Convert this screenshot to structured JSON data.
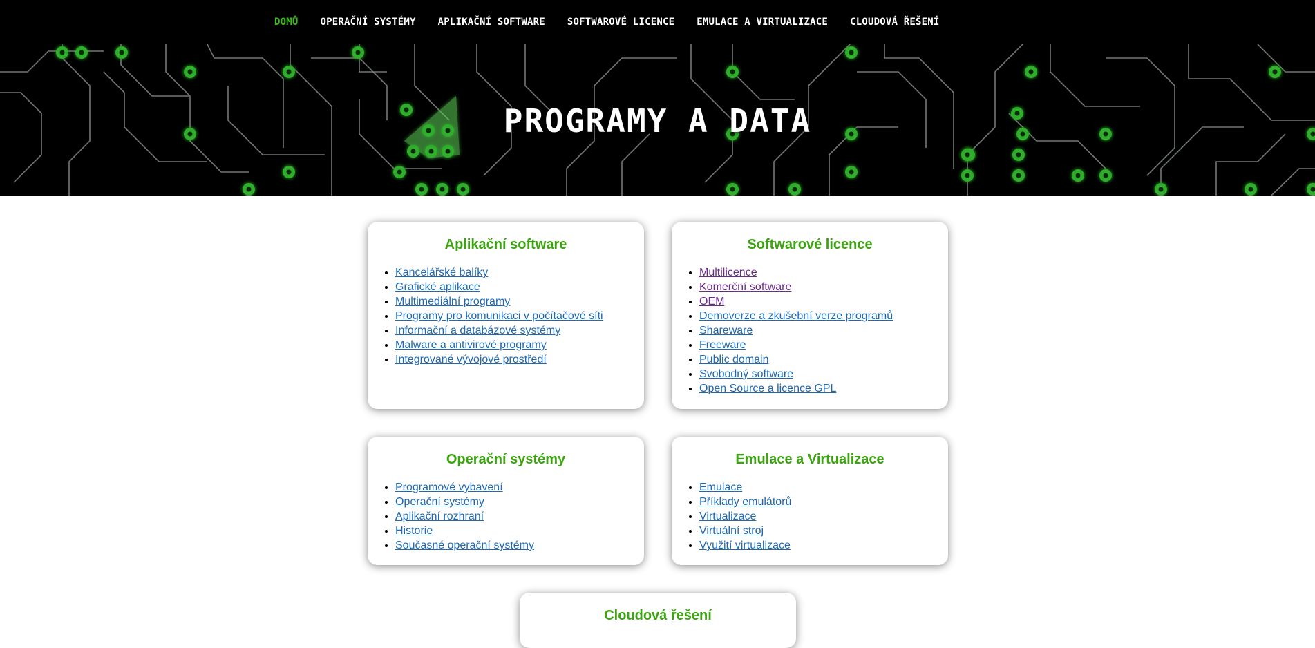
{
  "nav": [
    {
      "label": "DOMŮ",
      "active": true
    },
    {
      "label": "OPERAČNÍ SYSTÉMY",
      "active": false
    },
    {
      "label": "APLIKAČNÍ SOFTWARE",
      "active": false
    },
    {
      "label": "SOFTWAROVÉ LICENCE",
      "active": false
    },
    {
      "label": "EMULACE A VIRTUALIZACE",
      "active": false
    },
    {
      "label": "CLOUDOVÁ ŘEŠENÍ",
      "active": false
    }
  ],
  "hero": {
    "title": "PROGRAMY A DATA"
  },
  "colors": {
    "accent": "#3aa50f",
    "nav_active": "#3cbf1c",
    "link": "#1d69b4",
    "visited": "#6b2c8f"
  },
  "cards": [
    {
      "title": "Aplikační software",
      "links": [
        {
          "label": "Kancelářské balíky"
        },
        {
          "label": "Grafické aplikace"
        },
        {
          "label": "Multimediální programy"
        },
        {
          "label": "Programy pro komunikaci v počítačové síti"
        },
        {
          "label": "Informační a databázové systémy"
        },
        {
          "label": "Malware a antivirové programy"
        },
        {
          "label": "Integrované vývojové prostředí"
        }
      ]
    },
    {
      "title": "Softwarové licence",
      "links": [
        {
          "label": "Multilicence",
          "visited": true
        },
        {
          "label": "Komerční software",
          "visited": true
        },
        {
          "label": "OEM",
          "visited": true
        },
        {
          "label": "Demoverze a zkušební verze programů"
        },
        {
          "label": "Shareware"
        },
        {
          "label": "Freeware"
        },
        {
          "label": "Public domain"
        },
        {
          "label": "Svobodný software"
        },
        {
          "label": "Open Source a licence GPL"
        }
      ]
    },
    {
      "title": "Operační systémy",
      "links": [
        {
          "label": "Programové vybavení"
        },
        {
          "label": "Operační systémy"
        },
        {
          "label": "Aplikační rozhraní"
        },
        {
          "label": "Historie"
        },
        {
          "label": "Současné operační systémy"
        }
      ]
    },
    {
      "title": "Emulace a Virtualizace",
      "links": [
        {
          "label": "Emulace"
        },
        {
          "label": "Příklady emulátorů"
        },
        {
          "label": "Virtualizace"
        },
        {
          "label": "Virtuální stroj"
        },
        {
          "label": "Využití virtualizace"
        }
      ]
    },
    {
      "title": "Cloudová řešení",
      "links": []
    }
  ]
}
